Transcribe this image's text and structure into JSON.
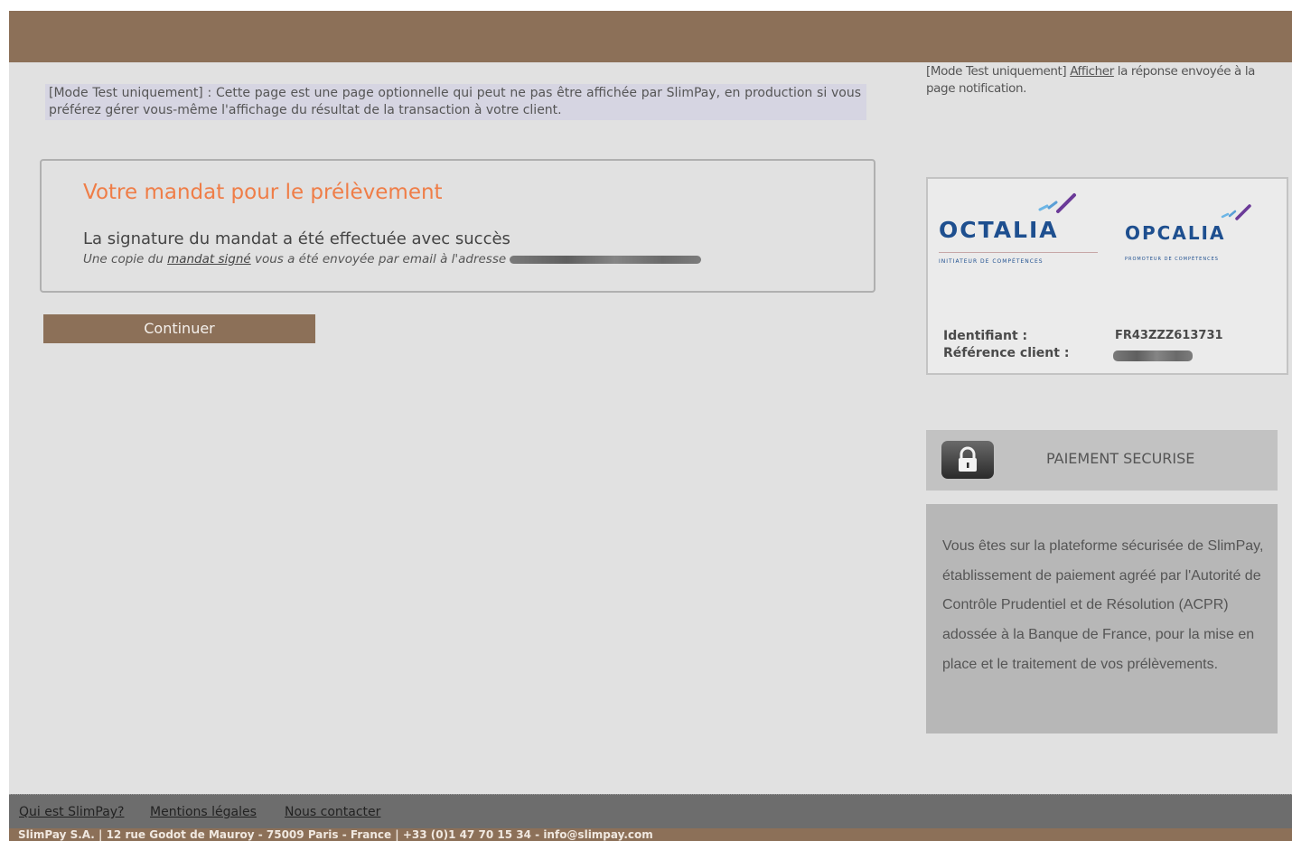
{
  "test_notice": {
    "main": "[Mode Test uniquement] : Cette page est une page optionnelle qui peut ne pas être affichée par SlimPay, en production si vous préférez gérer vous-même l'affichage du résultat de la transaction à votre client.",
    "side_prefix": "[Mode Test uniquement]",
    "side_link": "Afficher",
    "side_suffix": "la réponse envoyée à la page notification."
  },
  "mandate": {
    "title": "Votre mandat pour le prélèvement",
    "status": "La signature du mandat a été effectuée avec succès",
    "copy_prefix": "Une copie du",
    "copy_link": "mandat signé",
    "copy_suffix": "vous a été envoyée par email à l'adresse"
  },
  "continue_label": "Continuer",
  "creditor": {
    "logo1_name": "OCTALIA",
    "logo1_tagline": "INITIATEUR DE COMPÉTENCES",
    "logo2_name": "OPCALIA",
    "logo2_tagline": "PROMOTEUR DE COMPÉTENCES",
    "identifier_label": "Identifiant :",
    "identifier_value": "FR43ZZZ613731",
    "client_ref_label": "Référence client :"
  },
  "secure": {
    "label": "PAIEMENT SECURISE",
    "icon": "lock-icon",
    "info": "Vous êtes sur la plateforme sécurisée de SlimPay, établissement de paiement agréé par l'Autorité de Contrôle Prudentiel et de Résolution (ACPR) adossée à la Banque de France, pour la mise en place et le traitement de vos prélèvements."
  },
  "footer": {
    "links": [
      "Qui est SlimPay?",
      "Mentions légales",
      "Nous contacter"
    ],
    "address": "SlimPay S.A. | 12 rue Godot de Mauroy - 75009 Paris - France | +33 (0)1 47 70 15 34 - info@slimpay.com"
  },
  "colors": {
    "brand_brown": "#8c7058",
    "title_orange": "#ef7d47",
    "logo_blue": "#1e4f8f",
    "page_grey": "#e1e1e1"
  }
}
